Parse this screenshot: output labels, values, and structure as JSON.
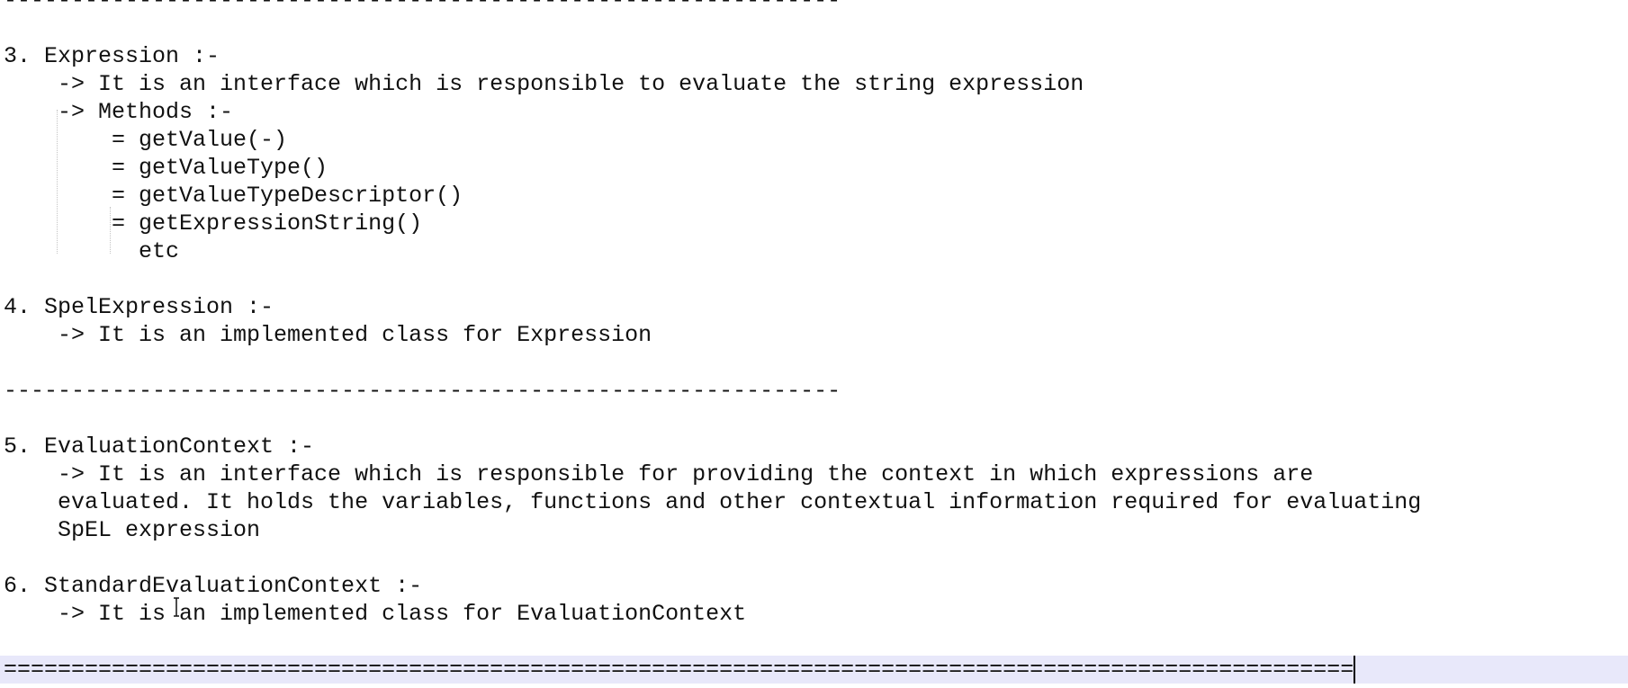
{
  "editor": {
    "lines": [
      "--------------------------------------------------------------",
      "",
      "3. Expression :-",
      "    -> It is an interface which is responsible to evaluate the string expression",
      "    -> Methods :-",
      "        = getValue(-)",
      "        = getValueType()",
      "        = getValueTypeDescriptor()",
      "        = getExpressionString()",
      "          etc",
      "",
      "4. SpelExpression :-",
      "    -> It is an implemented class for Expression",
      "",
      "--------------------------------------------------------------",
      "",
      "5. EvaluationContext :-",
      "    -> It is an interface which is responsible for providing the context in which expressions are",
      "    evaluated. It holds the variables, functions and other contextual information required for evaluating",
      "    SpEL expression",
      "",
      "6. StandardEvaluationContext :-",
      "    -> It is an implemented class for EvaluationContext",
      "",
      "===================================================================================================="
    ],
    "current_line_index": 24
  },
  "colors": {
    "text": "#111111",
    "background": "#ffffff",
    "current_line_highlight": "#e8e8fa",
    "indent_guide": "#c4c4c4",
    "caret": "#000000"
  },
  "icons": {
    "mouse_pointer": "ibeam-cursor-icon"
  }
}
